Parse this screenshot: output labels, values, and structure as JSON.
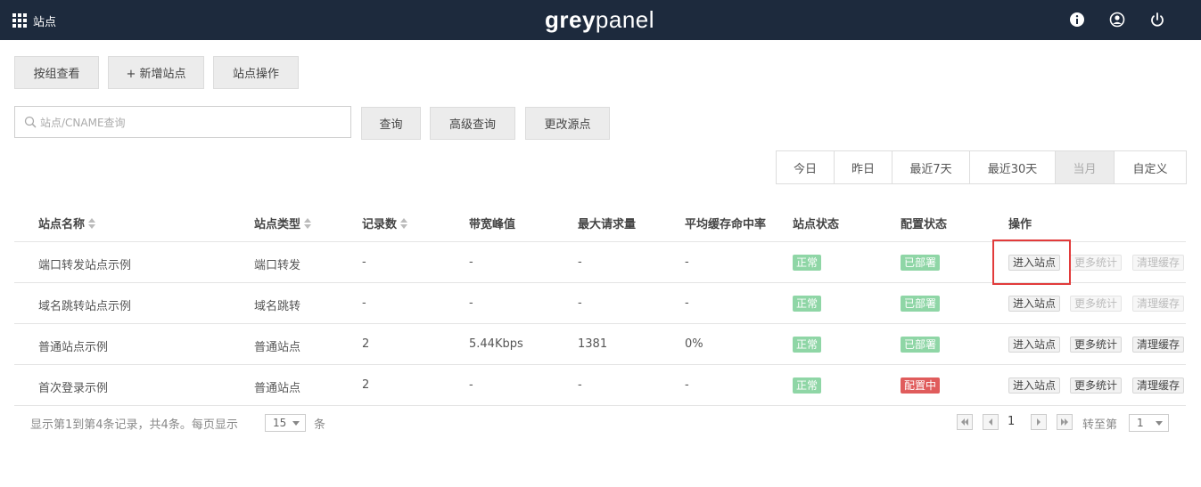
{
  "header": {
    "title": "站点",
    "logo_bold": "grey",
    "logo_light": "panel"
  },
  "toolbar": {
    "group_view": "按组查看",
    "add_site": "+ 新增站点",
    "site_ops": "站点操作"
  },
  "search": {
    "placeholder": "站点/CNAME查询",
    "query": "查询",
    "advanced": "高级查询",
    "change_origin": "更改源点"
  },
  "date_range": {
    "options": [
      "今日",
      "昨日",
      "最近7天",
      "最近30天",
      "当月",
      "自定义"
    ],
    "active": "当月"
  },
  "table": {
    "columns": [
      "站点名称",
      "站点类型",
      "记录数",
      "带宽峰值",
      "最大请求量",
      "平均缓存命中率",
      "站点状态",
      "配置状态",
      "操作"
    ],
    "rows": [
      {
        "name": "端口转发站点示例",
        "type": "端口转发",
        "records": "-",
        "bandwidth": "-",
        "max_req": "-",
        "hit_rate": "-",
        "status": "正常",
        "config": "已部署",
        "enter": "进入站点",
        "stats": "更多统计",
        "cache": "清理缓存"
      },
      {
        "name": "域名跳转站点示例",
        "type": "域名跳转",
        "records": "-",
        "bandwidth": "-",
        "max_req": "-",
        "hit_rate": "-",
        "status": "正常",
        "config": "已部署",
        "enter": "进入站点",
        "stats": "更多统计",
        "cache": "清理缓存"
      },
      {
        "name": "普通站点示例",
        "type": "普通站点",
        "records": "2",
        "bandwidth": "5.44Kbps",
        "max_req": "1381",
        "hit_rate": "0%",
        "status": "正常",
        "config": "已部署",
        "enter": "进入站点",
        "stats": "更多统计",
        "cache": "清理缓存"
      },
      {
        "name": "首次登录示例",
        "type": "普通站点",
        "records": "2",
        "bandwidth": "-",
        "max_req": "-",
        "hit_rate": "-",
        "status": "正常",
        "config": "配置中",
        "enter": "进入站点",
        "stats": "更多统计",
        "cache": "清理缓存"
      }
    ]
  },
  "footer": {
    "info": "显示第1到第4条记录，共4条。每页显示",
    "page_size": "15",
    "unit": "条",
    "current_page": "1",
    "goto_label": "转至第",
    "goto_value": "1"
  },
  "colors": {
    "topbar": "#1d2a3d",
    "status_ok": "#8fd6a6",
    "status_config": "#e05c5c",
    "highlight": "#e23b3b"
  }
}
